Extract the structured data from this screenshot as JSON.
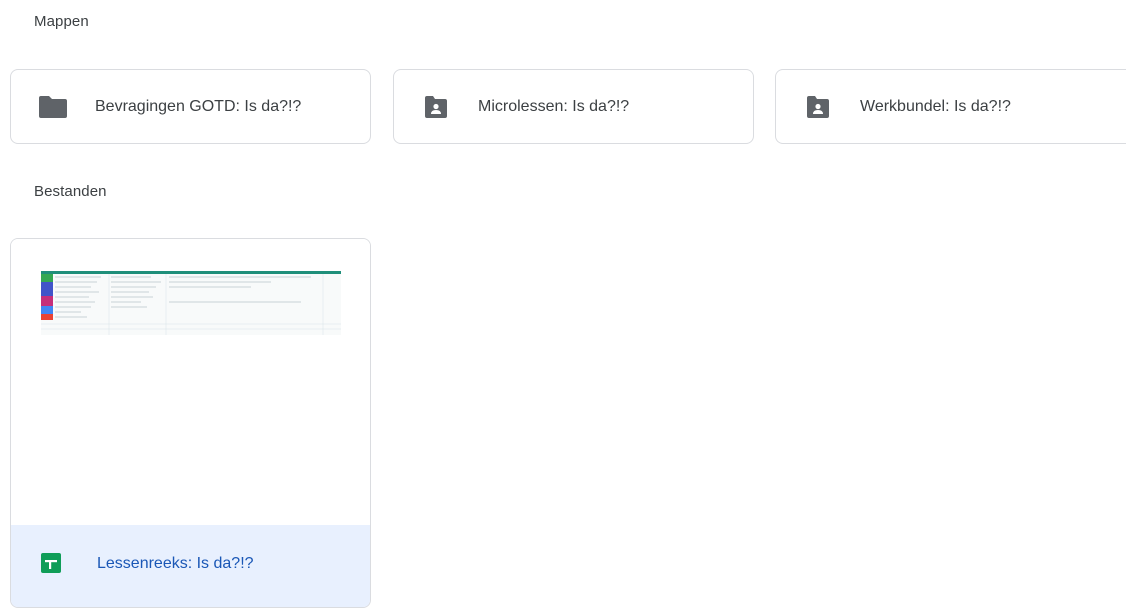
{
  "sections": {
    "folders_heading": "Mappen",
    "files_heading": "Bestanden"
  },
  "folders": [
    {
      "name": "Bevragingen GOTD: Is da?!?",
      "icon": "folder-icon"
    },
    {
      "name": "Microlessen: Is da?!?",
      "icon": "shared-folder-icon"
    },
    {
      "name": "Werkbundel: Is da?!?",
      "icon": "shared-folder-icon"
    }
  ],
  "files": [
    {
      "name": "Lessenreeks: Is da?!?",
      "icon": "google-sheets-icon",
      "selected": true
    }
  ],
  "colors": {
    "selected_bg": "#e8f0fe",
    "selected_text": "#1a57b6",
    "icon_gray": "#5f6368",
    "sheets_green": "#0f9d58"
  }
}
